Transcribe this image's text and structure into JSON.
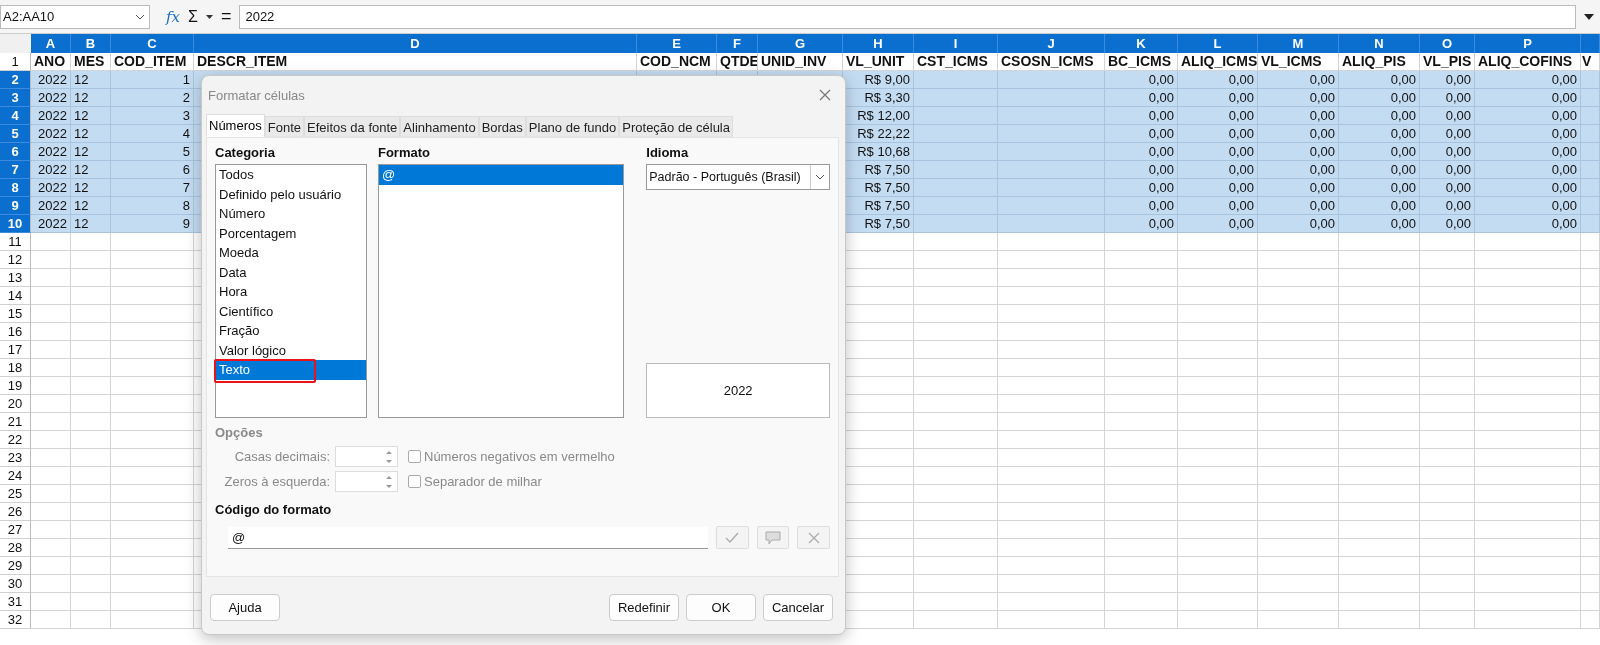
{
  "formula_bar": {
    "name_box": "A2:AA10",
    "function_wizard": "fx",
    "sum": "Σ",
    "equals": "=",
    "content": "2022"
  },
  "sheet": {
    "columns": [
      {
        "letter": "A",
        "selected": true
      },
      {
        "letter": "B",
        "selected": true
      },
      {
        "letter": "C",
        "selected": true
      },
      {
        "letter": "D",
        "selected": true
      },
      {
        "letter": "E",
        "selected": true
      },
      {
        "letter": "F",
        "selected": true
      },
      {
        "letter": "G",
        "selected": true
      },
      {
        "letter": "H",
        "selected": true
      },
      {
        "letter": "I",
        "selected": true
      },
      {
        "letter": "J",
        "selected": true
      },
      {
        "letter": "K",
        "selected": true
      },
      {
        "letter": "L",
        "selected": true
      },
      {
        "letter": "M",
        "selected": true
      },
      {
        "letter": "N",
        "selected": true
      },
      {
        "letter": "O",
        "selected": true
      },
      {
        "letter": "P",
        "selected": true
      },
      {
        "selected": true
      }
    ],
    "rows": [
      {
        "number": "1",
        "selected": false,
        "kind": "header",
        "cells": [
          "ANO",
          "MES",
          "COD_ITEM",
          "DESCR_ITEM",
          "COD_NCM",
          "QTDE",
          "UNID_INV",
          "VL_UNIT",
          "CST_ICMS",
          "CSOSN_ICMS",
          "BC_ICMS",
          "ALIQ_ICMS",
          "VL_ICMS",
          "ALIQ_PIS",
          "VL_PIS",
          "ALIQ_COFINS",
          "V"
        ]
      },
      {
        "number": "2",
        "selected": true,
        "kind": "data",
        "cells": [
          "2022",
          "12",
          "1",
          null,
          null,
          null,
          null,
          "R$ 9,00",
          null,
          null,
          "0,00",
          "0,00",
          "0,00",
          "0,00",
          "0,00",
          "0,00",
          null
        ]
      },
      {
        "number": "3",
        "selected": true,
        "kind": "data",
        "cells": [
          "2022",
          "12",
          "2",
          null,
          null,
          null,
          null,
          "R$ 3,30",
          null,
          null,
          "0,00",
          "0,00",
          "0,00",
          "0,00",
          "0,00",
          "0,00",
          null
        ]
      },
      {
        "number": "4",
        "selected": true,
        "kind": "data",
        "cells": [
          "2022",
          "12",
          "3",
          null,
          null,
          null,
          null,
          "R$ 12,00",
          null,
          null,
          "0,00",
          "0,00",
          "0,00",
          "0,00",
          "0,00",
          "0,00",
          null
        ]
      },
      {
        "number": "5",
        "selected": true,
        "kind": "data",
        "cells": [
          "2022",
          "12",
          "4",
          null,
          null,
          null,
          null,
          "R$ 22,22",
          null,
          null,
          "0,00",
          "0,00",
          "0,00",
          "0,00",
          "0,00",
          "0,00",
          null
        ]
      },
      {
        "number": "6",
        "selected": true,
        "kind": "data",
        "cells": [
          "2022",
          "12",
          "5",
          null,
          null,
          null,
          null,
          "R$ 10,68",
          null,
          null,
          "0,00",
          "0,00",
          "0,00",
          "0,00",
          "0,00",
          "0,00",
          null
        ]
      },
      {
        "number": "7",
        "selected": true,
        "kind": "data",
        "cells": [
          "2022",
          "12",
          "6",
          null,
          null,
          null,
          null,
          "R$ 7,50",
          null,
          null,
          "0,00",
          "0,00",
          "0,00",
          "0,00",
          "0,00",
          "0,00",
          null
        ]
      },
      {
        "number": "8",
        "selected": true,
        "kind": "data",
        "cells": [
          "2022",
          "12",
          "7",
          null,
          null,
          null,
          null,
          "R$ 7,50",
          null,
          null,
          "0,00",
          "0,00",
          "0,00",
          "0,00",
          "0,00",
          "0,00",
          null
        ]
      },
      {
        "number": "9",
        "selected": true,
        "kind": "data",
        "cells": [
          "2022",
          "12",
          "8",
          null,
          null,
          null,
          null,
          "R$ 7,50",
          null,
          null,
          "0,00",
          "0,00",
          "0,00",
          "0,00",
          "0,00",
          "0,00",
          null
        ]
      },
      {
        "number": "10",
        "selected": true,
        "kind": "data",
        "cells": [
          "2022",
          "12",
          "9",
          null,
          null,
          null,
          null,
          "R$ 7,50",
          null,
          null,
          "0,00",
          "0,00",
          "0,00",
          "0,00",
          "0,00",
          "0,00",
          null
        ]
      },
      {
        "number": "11",
        "selected": false,
        "kind": "empty"
      },
      {
        "number": "12",
        "selected": false,
        "kind": "empty"
      },
      {
        "number": "13",
        "selected": false,
        "kind": "empty"
      },
      {
        "number": "14",
        "selected": false,
        "kind": "empty"
      },
      {
        "number": "15",
        "selected": false,
        "kind": "empty"
      },
      {
        "number": "16",
        "selected": false,
        "kind": "empty"
      },
      {
        "number": "17",
        "selected": false,
        "kind": "empty"
      },
      {
        "number": "18",
        "selected": false,
        "kind": "empty"
      },
      {
        "number": "19",
        "selected": false,
        "kind": "empty"
      },
      {
        "number": "20",
        "selected": false,
        "kind": "empty"
      },
      {
        "number": "21",
        "selected": false,
        "kind": "empty"
      },
      {
        "number": "22",
        "selected": false,
        "kind": "empty"
      },
      {
        "number": "23",
        "selected": false,
        "kind": "empty"
      },
      {
        "number": "24",
        "selected": false,
        "kind": "empty"
      },
      {
        "number": "25",
        "selected": false,
        "kind": "empty"
      },
      {
        "number": "26",
        "selected": false,
        "kind": "empty"
      },
      {
        "number": "27",
        "selected": false,
        "kind": "empty"
      },
      {
        "number": "28",
        "selected": false,
        "kind": "empty"
      },
      {
        "number": "29",
        "selected": false,
        "kind": "empty"
      },
      {
        "number": "30",
        "selected": false,
        "kind": "empty"
      },
      {
        "number": "31",
        "selected": false,
        "kind": "empty"
      },
      {
        "number": "32",
        "selected": false,
        "kind": "empty"
      }
    ]
  },
  "dialog": {
    "title": "Formatar células",
    "tabs": [
      {
        "label": "Números",
        "selected": true
      },
      {
        "label": "Fonte",
        "selected": false
      },
      {
        "label": "Efeitos da fonte",
        "selected": false
      },
      {
        "label": "Alinhamento",
        "selected": false
      },
      {
        "label": "Bordas",
        "selected": false
      },
      {
        "label": "Plano de fundo",
        "selected": false
      },
      {
        "label": "Proteção de célula",
        "selected": false
      }
    ],
    "categoria": {
      "label": "Categoria",
      "items": [
        {
          "label": "Todos",
          "selected": false,
          "outlined": false
        },
        {
          "label": "Definido pelo usuário",
          "selected": false,
          "outlined": false
        },
        {
          "label": "Número",
          "selected": false,
          "outlined": false
        },
        {
          "label": "Porcentagem",
          "selected": false,
          "outlined": false
        },
        {
          "label": "Moeda",
          "selected": false,
          "outlined": false
        },
        {
          "label": "Data",
          "selected": false,
          "outlined": false
        },
        {
          "label": "Hora",
          "selected": false,
          "outlined": false
        },
        {
          "label": "Científico",
          "selected": false,
          "outlined": false
        },
        {
          "label": "Fração",
          "selected": false,
          "outlined": false
        },
        {
          "label": "Valor lógico",
          "selected": false,
          "outlined": false
        },
        {
          "label": "Texto",
          "selected": true,
          "outlined": true
        }
      ]
    },
    "formato": {
      "label": "Formato",
      "items": [
        {
          "label": "@",
          "selected": true
        }
      ]
    },
    "idioma": {
      "label": "Idioma",
      "value": "Padrão - Português (Brasil)"
    },
    "preview": "2022",
    "options": {
      "label": "Opções",
      "disabled": true,
      "fields": [
        {
          "label": "Casas decimais:"
        },
        {
          "label": "Zeros à esquerda:"
        }
      ],
      "checkboxes": [
        {
          "label": "Números negativos em vermelho",
          "checked": false
        },
        {
          "label": "Separador de milhar",
          "checked": false
        }
      ]
    },
    "format_code": {
      "label": "Código do formato",
      "value": "@"
    },
    "buttons": [
      {
        "label": "Ajuda",
        "kind": "help"
      },
      {
        "label": "Redefinir",
        "kind": "action"
      },
      {
        "label": "OK",
        "kind": "action"
      },
      {
        "label": "Cancelar",
        "kind": "action"
      }
    ]
  }
}
